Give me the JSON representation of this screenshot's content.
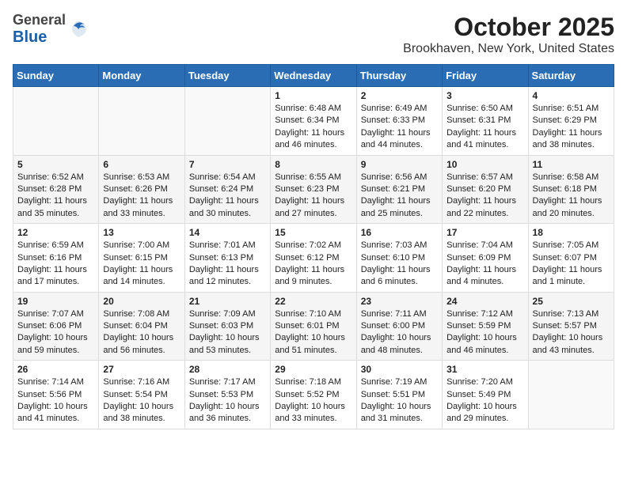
{
  "header": {
    "logo_general": "General",
    "logo_blue": "Blue",
    "title": "October 2025",
    "subtitle": "Brookhaven, New York, United States"
  },
  "days_of_week": [
    "Sunday",
    "Monday",
    "Tuesday",
    "Wednesday",
    "Thursday",
    "Friday",
    "Saturday"
  ],
  "weeks": [
    [
      {
        "day": "",
        "info": ""
      },
      {
        "day": "",
        "info": ""
      },
      {
        "day": "",
        "info": ""
      },
      {
        "day": "1",
        "info": "Sunrise: 6:48 AM\nSunset: 6:34 PM\nDaylight: 11 hours and 46 minutes."
      },
      {
        "day": "2",
        "info": "Sunrise: 6:49 AM\nSunset: 6:33 PM\nDaylight: 11 hours and 44 minutes."
      },
      {
        "day": "3",
        "info": "Sunrise: 6:50 AM\nSunset: 6:31 PM\nDaylight: 11 hours and 41 minutes."
      },
      {
        "day": "4",
        "info": "Sunrise: 6:51 AM\nSunset: 6:29 PM\nDaylight: 11 hours and 38 minutes."
      }
    ],
    [
      {
        "day": "5",
        "info": "Sunrise: 6:52 AM\nSunset: 6:28 PM\nDaylight: 11 hours and 35 minutes."
      },
      {
        "day": "6",
        "info": "Sunrise: 6:53 AM\nSunset: 6:26 PM\nDaylight: 11 hours and 33 minutes."
      },
      {
        "day": "7",
        "info": "Sunrise: 6:54 AM\nSunset: 6:24 PM\nDaylight: 11 hours and 30 minutes."
      },
      {
        "day": "8",
        "info": "Sunrise: 6:55 AM\nSunset: 6:23 PM\nDaylight: 11 hours and 27 minutes."
      },
      {
        "day": "9",
        "info": "Sunrise: 6:56 AM\nSunset: 6:21 PM\nDaylight: 11 hours and 25 minutes."
      },
      {
        "day": "10",
        "info": "Sunrise: 6:57 AM\nSunset: 6:20 PM\nDaylight: 11 hours and 22 minutes."
      },
      {
        "day": "11",
        "info": "Sunrise: 6:58 AM\nSunset: 6:18 PM\nDaylight: 11 hours and 20 minutes."
      }
    ],
    [
      {
        "day": "12",
        "info": "Sunrise: 6:59 AM\nSunset: 6:16 PM\nDaylight: 11 hours and 17 minutes."
      },
      {
        "day": "13",
        "info": "Sunrise: 7:00 AM\nSunset: 6:15 PM\nDaylight: 11 hours and 14 minutes."
      },
      {
        "day": "14",
        "info": "Sunrise: 7:01 AM\nSunset: 6:13 PM\nDaylight: 11 hours and 12 minutes."
      },
      {
        "day": "15",
        "info": "Sunrise: 7:02 AM\nSunset: 6:12 PM\nDaylight: 11 hours and 9 minutes."
      },
      {
        "day": "16",
        "info": "Sunrise: 7:03 AM\nSunset: 6:10 PM\nDaylight: 11 hours and 6 minutes."
      },
      {
        "day": "17",
        "info": "Sunrise: 7:04 AM\nSunset: 6:09 PM\nDaylight: 11 hours and 4 minutes."
      },
      {
        "day": "18",
        "info": "Sunrise: 7:05 AM\nSunset: 6:07 PM\nDaylight: 11 hours and 1 minute."
      }
    ],
    [
      {
        "day": "19",
        "info": "Sunrise: 7:07 AM\nSunset: 6:06 PM\nDaylight: 10 hours and 59 minutes."
      },
      {
        "day": "20",
        "info": "Sunrise: 7:08 AM\nSunset: 6:04 PM\nDaylight: 10 hours and 56 minutes."
      },
      {
        "day": "21",
        "info": "Sunrise: 7:09 AM\nSunset: 6:03 PM\nDaylight: 10 hours and 53 minutes."
      },
      {
        "day": "22",
        "info": "Sunrise: 7:10 AM\nSunset: 6:01 PM\nDaylight: 10 hours and 51 minutes."
      },
      {
        "day": "23",
        "info": "Sunrise: 7:11 AM\nSunset: 6:00 PM\nDaylight: 10 hours and 48 minutes."
      },
      {
        "day": "24",
        "info": "Sunrise: 7:12 AM\nSunset: 5:59 PM\nDaylight: 10 hours and 46 minutes."
      },
      {
        "day": "25",
        "info": "Sunrise: 7:13 AM\nSunset: 5:57 PM\nDaylight: 10 hours and 43 minutes."
      }
    ],
    [
      {
        "day": "26",
        "info": "Sunrise: 7:14 AM\nSunset: 5:56 PM\nDaylight: 10 hours and 41 minutes."
      },
      {
        "day": "27",
        "info": "Sunrise: 7:16 AM\nSunset: 5:54 PM\nDaylight: 10 hours and 38 minutes."
      },
      {
        "day": "28",
        "info": "Sunrise: 7:17 AM\nSunset: 5:53 PM\nDaylight: 10 hours and 36 minutes."
      },
      {
        "day": "29",
        "info": "Sunrise: 7:18 AM\nSunset: 5:52 PM\nDaylight: 10 hours and 33 minutes."
      },
      {
        "day": "30",
        "info": "Sunrise: 7:19 AM\nSunset: 5:51 PM\nDaylight: 10 hours and 31 minutes."
      },
      {
        "day": "31",
        "info": "Sunrise: 7:20 AM\nSunset: 5:49 PM\nDaylight: 10 hours and 29 minutes."
      },
      {
        "day": "",
        "info": ""
      }
    ]
  ]
}
